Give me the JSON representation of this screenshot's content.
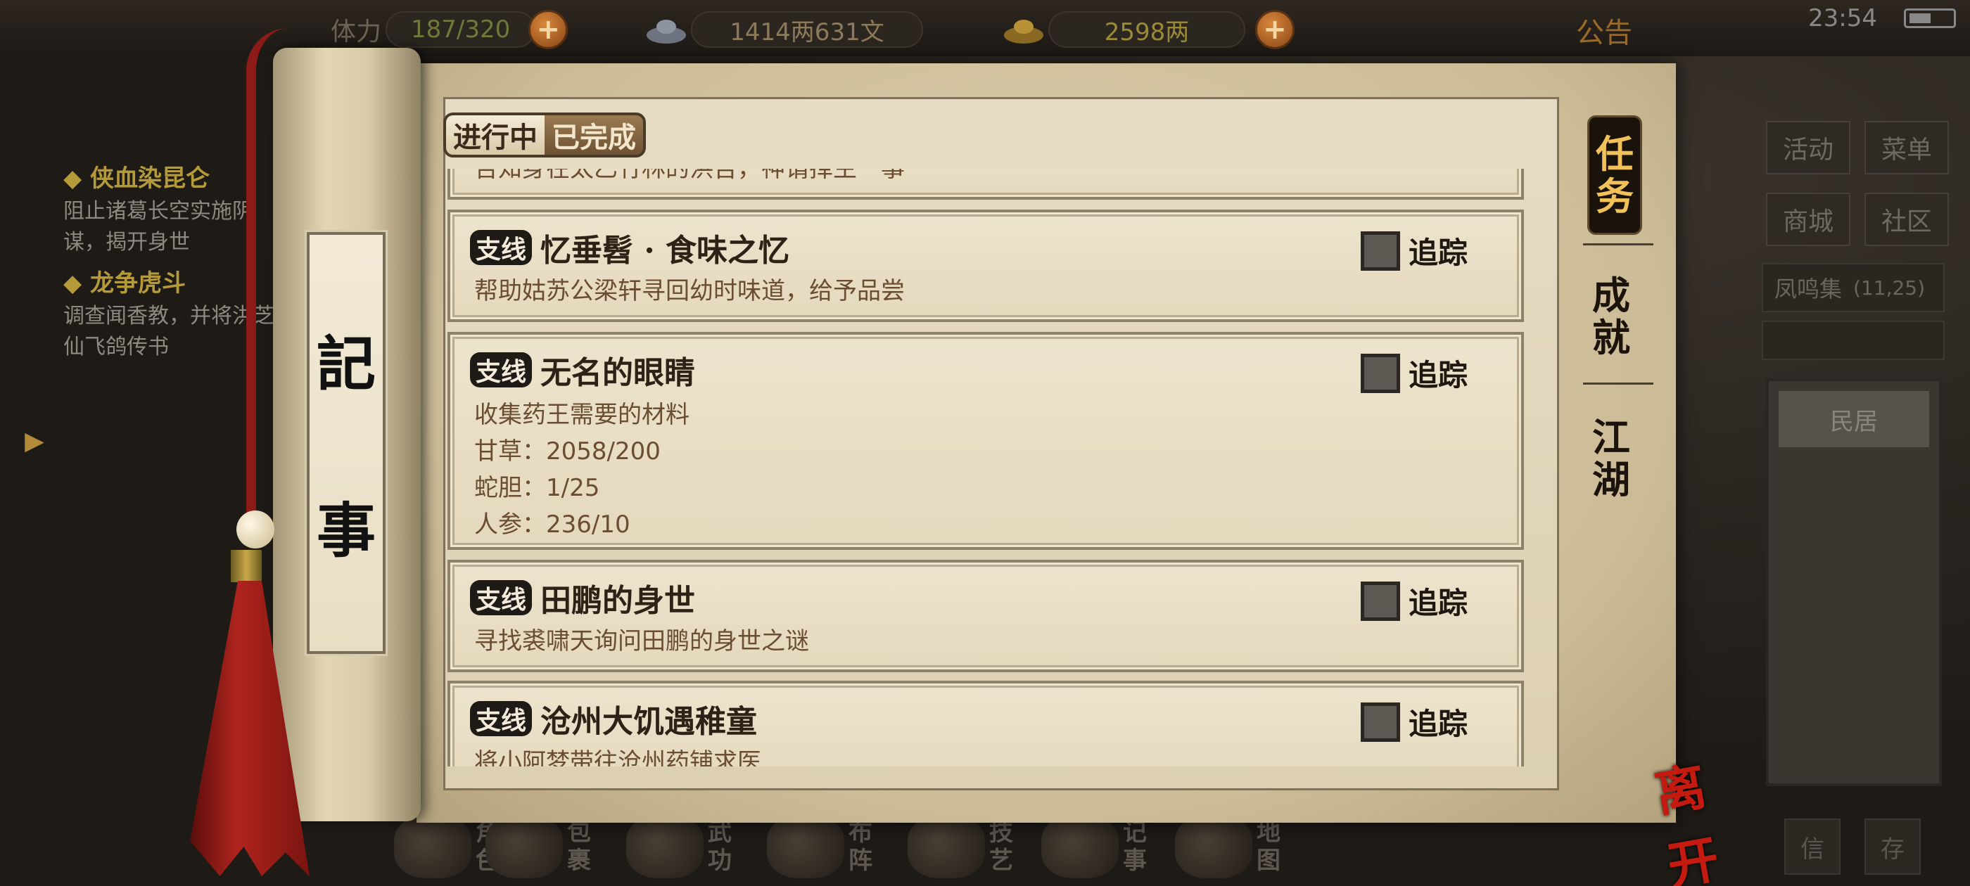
{
  "top_bar": {
    "stamina_label": "体力",
    "stamina_value": "187/320",
    "copper_value": "1414两631文",
    "gold_value": "2598两",
    "notice_label": "公告",
    "clock": "23:54"
  },
  "left_log": {
    "quests": [
      {
        "title": "◆ 侠血染昆仑",
        "desc": "阻止诸葛长空实施阴谋，揭开身世"
      },
      {
        "title": "◆ 龙争虎斗",
        "desc": "调查闻香教，并将洪芝仙飞鸽传书"
      }
    ]
  },
  "side_menu": {
    "activity": "活动",
    "menu": "菜单",
    "shop": "商城",
    "community": "社区",
    "location": "凤鸣集",
    "coords": "(11,25)",
    "house": "民居"
  },
  "scroll": {
    "rod_chars": [
      "記",
      "事"
    ]
  },
  "tabs": {
    "in_progress": "进行中",
    "completed": "已完成"
  },
  "quests": [
    {
      "tag": "",
      "title": "",
      "desc": "告知身在太乙竹林的洪吉，神谓择主一事",
      "track_label": ""
    },
    {
      "tag": "支线",
      "title": "忆垂髫 · 食味之忆",
      "desc": "帮助姑苏公梁轩寻回幼时味道，给予品尝",
      "track_label": "追踪"
    },
    {
      "tag": "支线",
      "title": "无名的眼睛",
      "desc": "收集药王需要的材料",
      "items": [
        "甘草：2058/200",
        "蛇胆：1/25",
        "人参：236/10"
      ],
      "track_label": "追踪"
    },
    {
      "tag": "支线",
      "title": "田鹏的身世",
      "desc": "寻找裘啸天询问田鹏的身世之谜",
      "track_label": "追踪"
    },
    {
      "tag": "支线",
      "title": "沧州大饥遇稚童",
      "desc": "将小阿梦带往沧州药铺求医",
      "track_label": "追踪"
    }
  ],
  "right_tabs": {
    "task": [
      "任",
      "务"
    ],
    "achievement": [
      "成",
      "就"
    ],
    "jianghu": [
      "江",
      "湖"
    ]
  },
  "bottom_nav": [
    {
      "label": "角色"
    },
    {
      "label": "包裹"
    },
    {
      "label": "武功"
    },
    {
      "label": "布阵"
    },
    {
      "label": "技艺"
    },
    {
      "label": "记事"
    },
    {
      "label": "地图"
    }
  ],
  "leave_label": "离开",
  "mini_buttons": [
    "信",
    "存"
  ],
  "colors": {
    "accent_gold": "#f1c15a",
    "tassel_red": "#b0241e",
    "leave_red": "#c41a10"
  }
}
